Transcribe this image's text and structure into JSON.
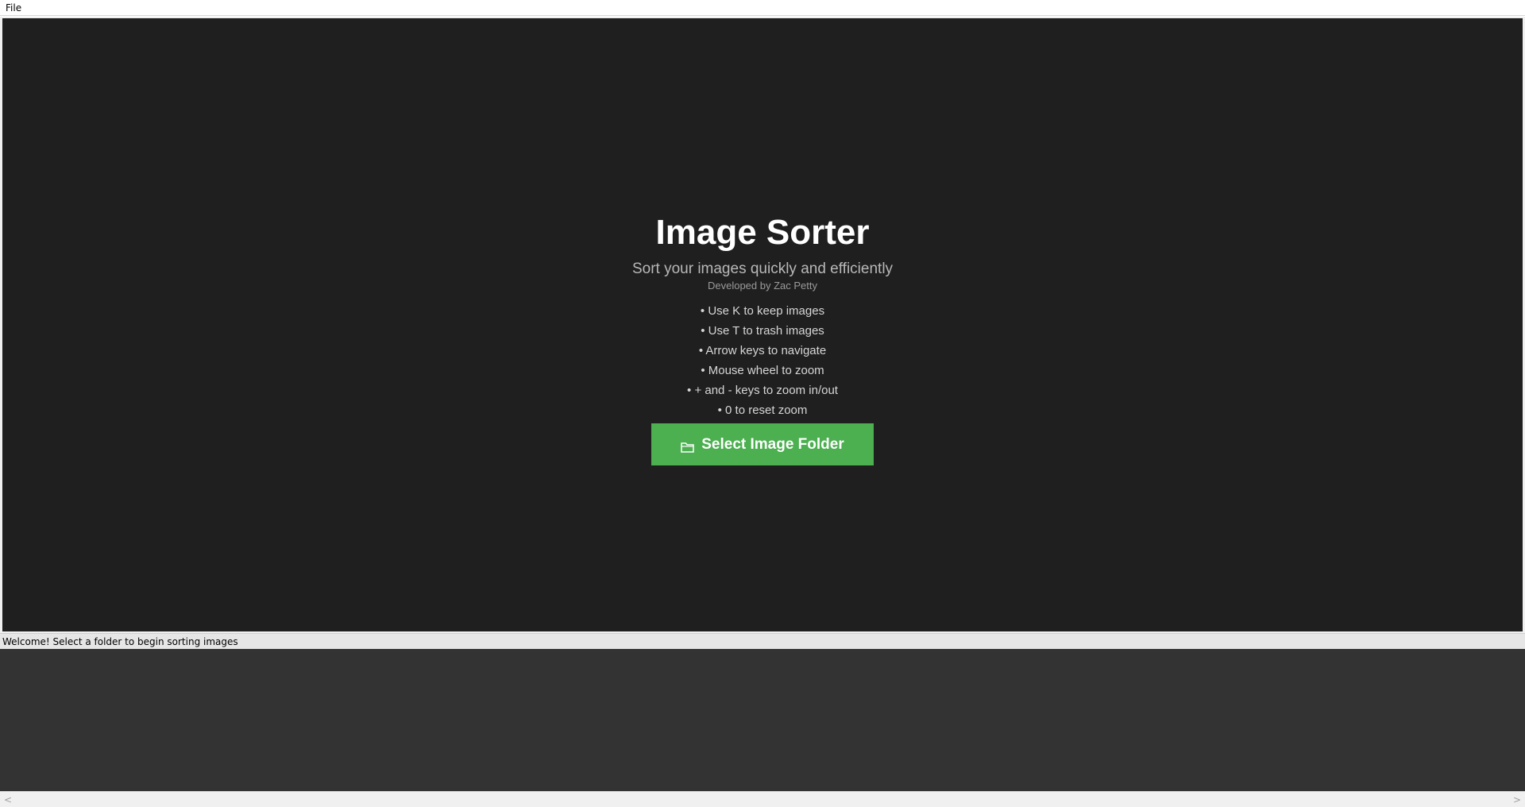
{
  "menubar": {
    "items": [
      {
        "label": "File"
      }
    ]
  },
  "welcome": {
    "title": "Image Sorter",
    "subtitle": "Sort your images quickly and efficiently",
    "developer": "Developed by Zac Petty",
    "instructions": [
      "• Use K to keep images",
      "• Use T to trash images",
      "• Arrow keys to navigate",
      "• Mouse wheel to zoom",
      "• + and - keys to zoom in/out",
      "• 0 to reset zoom"
    ],
    "button_label": "Select Image Folder",
    "button_icon": "folder-icon"
  },
  "statusbar": {
    "text": "Welcome! Select a folder to begin sorting images"
  },
  "scrollbar": {
    "left_arrow": "<",
    "right_arrow": ">"
  },
  "colors": {
    "canvas_bg": "#1f1f1f",
    "accent_green": "#4caf50",
    "thumb_panel_bg": "#333333"
  }
}
